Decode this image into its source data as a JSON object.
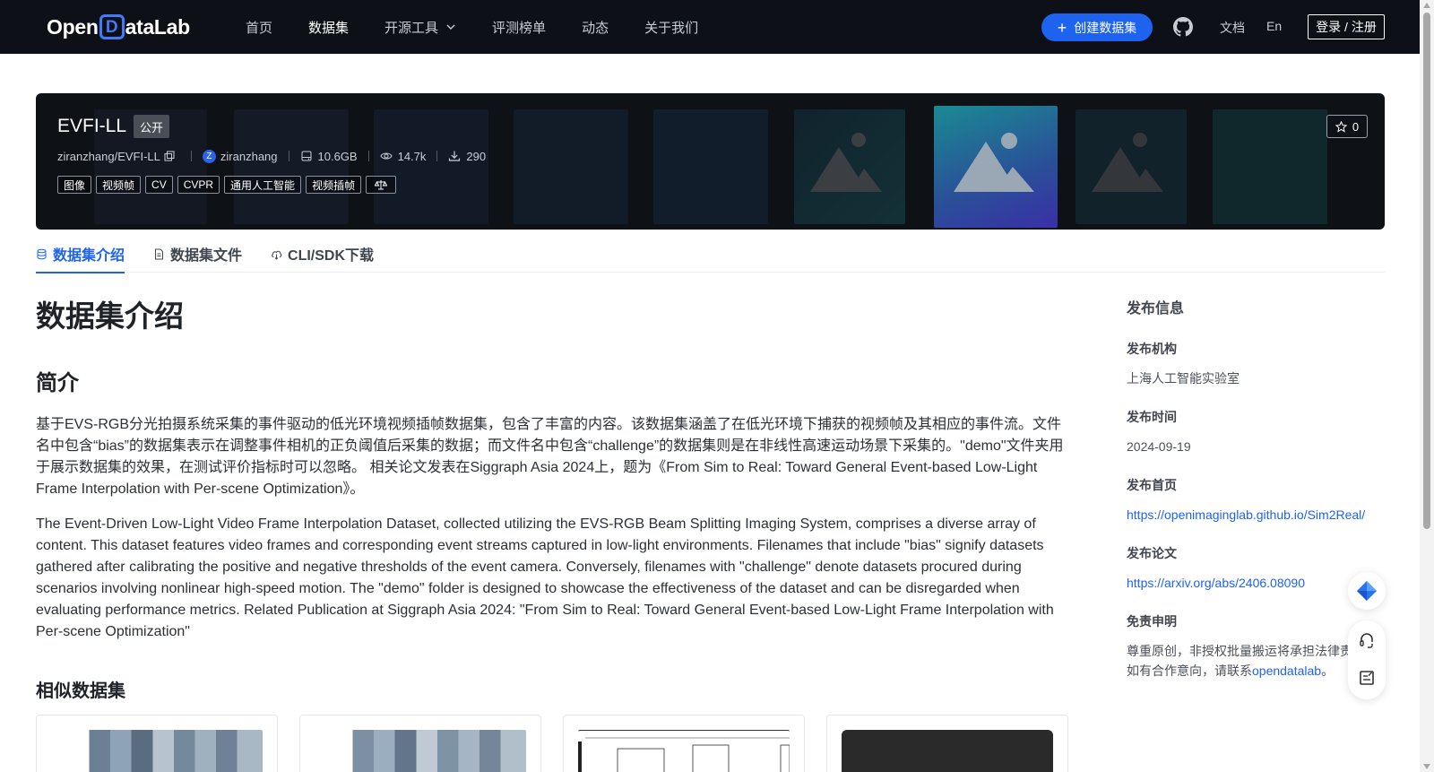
{
  "nav": {
    "logo_prefix": "Open",
    "logo_d": "D",
    "logo_suffix": "ataLab",
    "items": [
      {
        "label": "首页"
      },
      {
        "label": "数据集"
      },
      {
        "label": "开源工具"
      },
      {
        "label": "评测榜单"
      },
      {
        "label": "动态"
      },
      {
        "label": "关于我们"
      }
    ],
    "create_label": "创建数据集",
    "docs_label": "文档",
    "lang_label": "En",
    "login_label": "登录 / 注册"
  },
  "dataset": {
    "title": "EVFI-LL",
    "visibility": "公开",
    "repo": "ziranzhang/EVFI-LL",
    "owner_initial": "Z",
    "owner": "ziranzhang",
    "size": "10.6GB",
    "views": "14.7k",
    "downloads": "290",
    "tags": [
      "图像",
      "视频帧",
      "CV",
      "CVPR",
      "通用人工智能",
      "视频插帧"
    ],
    "stars": "0"
  },
  "tabs": [
    {
      "label": "数据集介绍"
    },
    {
      "label": "数据集文件"
    },
    {
      "label": "CLI/SDK下载"
    }
  ],
  "content": {
    "heading": "数据集介绍",
    "subheading": "简介",
    "para_zh": "基于EVS-RGB分光拍摄系统采集的事件驱动的低光环境视频插帧数据集，包含了丰富的内容。该数据集涵盖了在低光环境下捕获的视频帧及其相应的事件流。文件名中包含“bias”的数据集表示在调整事件相机的正负阈值后采集的数据；而文件名中包含“challenge”的数据集则是在非线性高速运动场景下采集的。\"demo\"文件夹用于展示数据集的效果，在测试评价指标时可以忽略。 相关论文发表在Siggraph Asia 2024上，题为《From Sim to Real: Toward General Event-based Low-Light Frame Interpolation with Per-scene Optimization》。",
    "para_en": "The Event-Driven Low-Light Video Frame Interpolation Dataset, collected utilizing the EVS-RGB Beam Splitting Imaging System, comprises a diverse array of content. This dataset features video frames and corresponding event streams captured in low-light environments. Filenames that include \"bias\" signify datasets gathered after calibrating the positive and negative thresholds of the event camera. Conversely, filenames with \"challenge\" denote datasets procured during scenarios involving nonlinear high-speed motion. The \"demo\" folder is designed to showcase the effectiveness of the dataset and can be disregarded when evaluating performance metrics. Related Publication at Siggraph Asia 2024: \"From Sim to Real: Toward General Event-based Low-Light Frame Interpolation with Per-scene Optimization\"",
    "similar_heading": "相似数据集"
  },
  "sidebar": {
    "title": "发布信息",
    "org_label": "发布机构",
    "org_value": "上海人工智能实验室",
    "time_label": "发布时间",
    "time_value": "2024-09-19",
    "home_label": "发布首页",
    "home_value": "https://openimaginglab.github.io/Sim2Real/",
    "paper_label": "发布论文",
    "paper_value": "https://arxiv.org/abs/2406.08090",
    "disclaimer_label": "免责申明",
    "disclaimer_line1": "尊重原创，非授权批量搬运将承担法律责",
    "disclaimer_line2_prefix": "如有合作意向，请联系",
    "disclaimer_link": "opendatalab",
    "disclaimer_suffix": "。"
  },
  "colors": {
    "accent": "#1e63ef",
    "nav_bg": "#0d1117",
    "banner_bg": "#0e1116"
  }
}
